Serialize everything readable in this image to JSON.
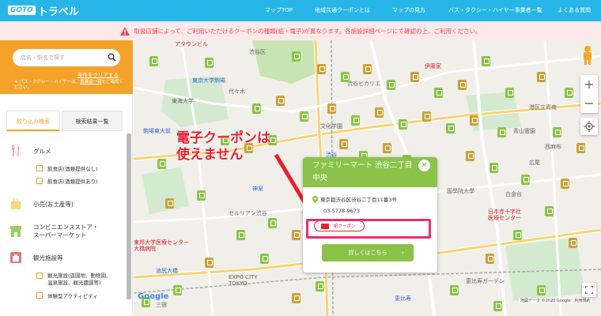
{
  "header": {
    "logo_badge": "GOTO",
    "logo_text": "トラベル",
    "nav": [
      "マップTOP",
      "地域共通クーポンとは",
      "マップの見方",
      "バス・タクシー・ハイヤー事業者一覧",
      "よくある質問"
    ]
  },
  "notice": {
    "text": "取扱店舗によって、ご利用いただけるクーポンの種類(紙・電子)が異なります。各施設詳細ページにて確認の上、ご利用ください。"
  },
  "sidebar": {
    "search_placeholder": "店名・駅名で探す",
    "clear_label": "条件をクリアする",
    "note_prefix": "※ バス・タクシー・ハイヤーは、",
    "note_link": "事業者一覧",
    "note_suffix": "をご確認ください。",
    "tabs": [
      "絞り込み検索",
      "検索結果一覧"
    ],
    "categories": [
      {
        "label": "グルメ"
      },
      {
        "label": "小売(お土産等)"
      },
      {
        "label": "コンビニエンスストア・\nスーパーマーケット"
      },
      {
        "label": "観光施設等"
      }
    ],
    "gourmet_sub": [
      "飲食店(酒類提供なし)",
      "飲食店(酒類提供あり)"
    ],
    "tourism_sub": [
      "観光施設(遊園地、動物園、\n温泉施設、観光農園等)",
      "体験型アクティビティ"
    ]
  },
  "map": {
    "labels": {
      "shibuya_ku": "渋谷区",
      "shibuya_scramble": "アタウンビル",
      "ishimori": "伊藤家",
      "meiji": "東京大学駒場",
      "tokai": "東海大学",
      "komaba": "駒場東大前",
      "shibuya_station": "渋谷",
      "shinsen": "神泉",
      "ikejiri": "池尻大橋",
      "sangenjaya": "三宿",
      "ebisu": "恵比寿",
      "hiroo": "広尾",
      "nishiazabu": "西麻布",
      "yoyogi": "代々木",
      "kokugakuin": "國學院大學",
      "nisseki": "日本赤十字社\n医療センター",
      "expo": "EXPO CITY\nTOKYO",
      "cerulean": "セルリアン渋谷",
      "bunka": "文化学園",
      "hikarie": "渋谷ヒカリエ",
      "ebisu_garden": "恵比寿ガーデン",
      "minatoku": "港区立青南",
      "shirokane": "白金台",
      "aoyama": "青山霊園",
      "toho": "東邦大学医療センター\n大橋病院",
      "google": "Google",
      "attribution": "地図データ ©2020 Google　利用規約"
    }
  },
  "annotation": {
    "line1": "電子クーポンは",
    "line2": "使えません"
  },
  "popup": {
    "title": "ファミリーマート 渋谷二丁目中央",
    "address": "東京都渋谷区渋谷二丁目11番3号",
    "tel": "03-5778-9673",
    "coupon": "紙クーポン",
    "detail": "詳しくはこちら",
    "close": "✕"
  },
  "colors": {
    "header": "#26b6e8",
    "accent": "#f3a32a",
    "green": "#8bc34a",
    "red": "#e8202e",
    "notice_bg": "#fde9ea"
  }
}
